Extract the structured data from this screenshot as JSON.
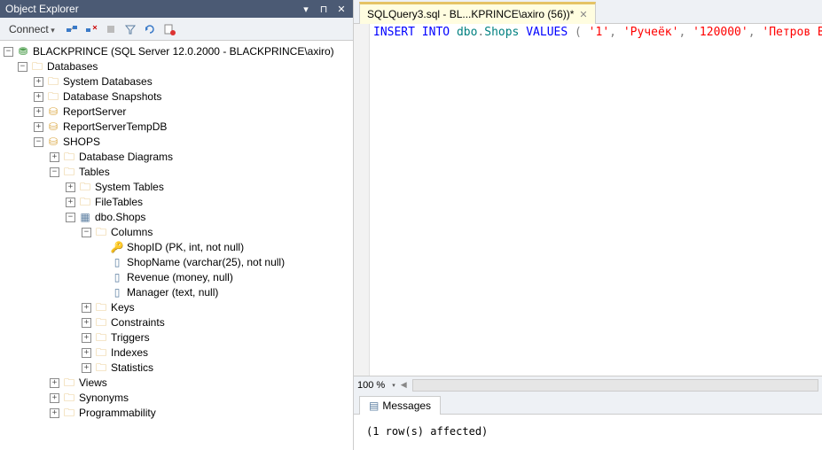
{
  "explorer": {
    "title": "Object Explorer",
    "connect_label": "Connect",
    "tree": {
      "server": "BLACKPRINCE (SQL Server 12.0.2000 - BLACKPRINCE\\axiro)",
      "databases": "Databases",
      "sys_db": "System Databases",
      "db_snap": "Database Snapshots",
      "report_srv": "ReportServer",
      "report_tmp": "ReportServerTempDB",
      "shops_db": "SHOPS",
      "db_diag": "Database Diagrams",
      "tables": "Tables",
      "sys_tables": "System Tables",
      "file_tables": "FileTables",
      "dbo_shops": "dbo.Shops",
      "columns": "Columns",
      "col_shopid": "ShopID (PK, int, not null)",
      "col_shopname": "ShopName (varchar(25), not null)",
      "col_revenue": "Revenue (money, null)",
      "col_manager": "Manager (text, null)",
      "keys": "Keys",
      "constraints": "Constraints",
      "triggers": "Triggers",
      "indexes": "Indexes",
      "statistics": "Statistics",
      "views": "Views",
      "synonyms": "Synonyms",
      "programmability": "Programmability"
    }
  },
  "editor": {
    "tab_label": "SQLQuery3.sql - BL...KPRINCE\\axiro (56))*",
    "zoom": "100 %",
    "sql": {
      "kw1": "INSERT",
      "kw2": "INTO",
      "obj1": "dbo",
      "obj2": "Shops",
      "kw3": "VALUES",
      "lp": "(",
      "v1": "'1'",
      "c": ",",
      "v2": "'Ручеёк'",
      "v3": "'120000'",
      "v4": "'Петров В.И.'",
      "rp": ")"
    }
  },
  "messages": {
    "tab_label": "Messages",
    "body": "(1 row(s) affected)"
  }
}
